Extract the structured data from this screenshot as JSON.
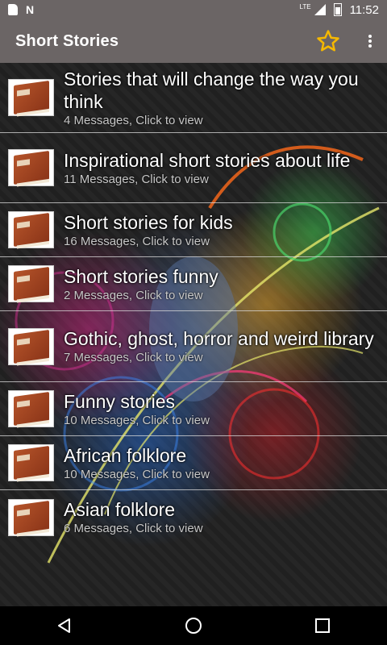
{
  "status_bar": {
    "time": "11:52",
    "network": "LTE",
    "icons": [
      "sd-card-icon",
      "n-icon",
      "signal-icon",
      "battery-icon"
    ]
  },
  "app_bar": {
    "title": "Short Stories",
    "favorite_icon": "star-outline-icon",
    "menu_icon": "more-vert-icon",
    "accent": "#f5b800"
  },
  "stories": [
    {
      "title": "Stories that will change the way you think",
      "subtitle": "4 Messages, Click to view"
    },
    {
      "title": "Inspirational short stories about life",
      "subtitle": "11 Messages, Click to view"
    },
    {
      "title": "Short stories for kids",
      "subtitle": "16 Messages, Click to view"
    },
    {
      "title": "Short stories funny",
      "subtitle": "2 Messages, Click to view"
    },
    {
      "title": "Gothic, ghost, horror and weird library",
      "subtitle": "7 Messages, Click to view"
    },
    {
      "title": "Funny stories",
      "subtitle": "10 Messages, Click to view"
    },
    {
      "title": "African folklore",
      "subtitle": "10 Messages, Click to view"
    },
    {
      "title": "Asian folklore",
      "subtitle": "6 Messages, Click to view"
    }
  ],
  "nav_bar": {
    "back_icon": "back-triangle-icon",
    "home_icon": "home-circle-icon",
    "recents_icon": "recents-square-icon"
  }
}
